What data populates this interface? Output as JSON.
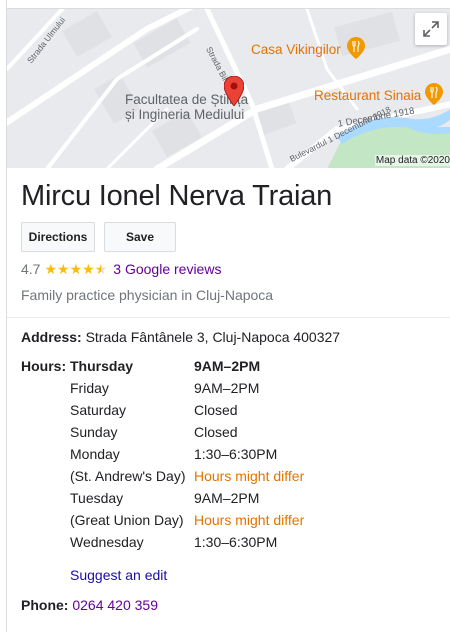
{
  "map": {
    "labels": {
      "faculty_line1": "Facultatea de Știința",
      "faculty_line2": "și Ingineria Mediului",
      "casa": "Casa Vikingilor",
      "restaurant": "Restaurant Sinaia",
      "road_ulmului": "Strada Ulmului",
      "road_bihorului": "Strada Bihorului",
      "road_bulevardul": "Bulevardul 1 Decembrie 1918",
      "road_decembrie": "Bulevardul 1 Decembrie 1918"
    },
    "attribution": "Map data ©2020",
    "expand_icon": "expand-icon",
    "colors": {
      "water": "#aadaff",
      "park": "#c3e6c5",
      "road": "#ffffff",
      "pin": "#ea4335",
      "poi": "#f29900"
    }
  },
  "place": {
    "name": "Mircu Ionel Nerva Traian",
    "rating": "4.7",
    "rating_stars": 4.7,
    "reviews_label": "3 Google reviews",
    "category": "Family practice physician in Cluj-Napoca"
  },
  "actions": {
    "directions_label": "Directions",
    "save_label": "Save"
  },
  "address": {
    "label": "Address:",
    "value": "Strada Fântânele 3, Cluj-Napoca 400327"
  },
  "hours": {
    "label": "Hours:",
    "rows": [
      {
        "day": "Thursday",
        "time": "9AM–2PM"
      },
      {
        "day": "Friday",
        "time": "9AM–2PM"
      },
      {
        "day": "Saturday",
        "time": "Closed"
      },
      {
        "day": "Sunday",
        "time": "Closed"
      },
      {
        "day": "Monday",
        "time": "1:30–6:30PM"
      },
      {
        "day": "(St. Andrew's Day)",
        "time": "Hours might differ"
      },
      {
        "day": "Tuesday",
        "time": "9AM–2PM"
      },
      {
        "day": "(Great Union Day)",
        "time": "Hours might differ"
      },
      {
        "day": "Wednesday",
        "time": "1:30–6:30PM"
      }
    ]
  },
  "suggest_edit": "Suggest an edit",
  "phone": {
    "label": "Phone:",
    "value": "0264 420 359"
  }
}
